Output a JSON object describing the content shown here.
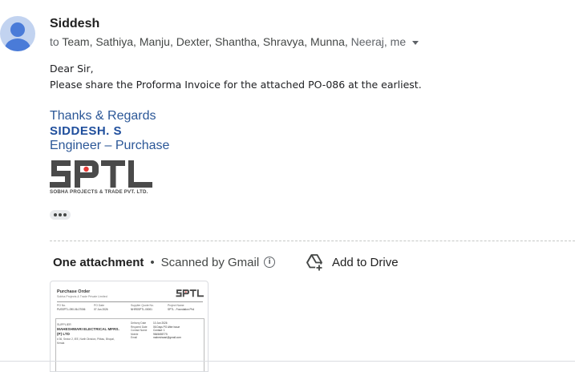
{
  "header": {
    "sender": "Siddesh",
    "to_prefix": "to",
    "recipients": "Team, Sathiya, Manju, Dexter, Shantha, Shravya, Munna,",
    "recipients_tail": "Neeraj, me"
  },
  "body": {
    "greeting": "Dear Sir,",
    "message": "Please share the Proforma Invoice for the attached PO-086 at the earliest."
  },
  "signature": {
    "line1": "Thanks & Regards",
    "name": "SIDDESH. S",
    "role": "Engineer – Purchase",
    "logo_text": "SPTL",
    "company": "SOBHA PROJECTS & TRADE PVT. LTD."
  },
  "attachments": {
    "title": "One attachment",
    "bullet": "•",
    "scanned": "Scanned by Gmail",
    "info_glyph": "i",
    "add_to_drive": "Add to Drive",
    "drive_icon": "add-to-drive-icon"
  },
  "thumbnail": {
    "doc_title": "Purchase Order",
    "doc_subtitle": "Sobha Projects & Trade Private Limited",
    "col_labels": [
      "PO No.",
      "PO Date",
      "Supplier Quote No.",
      "Project Name"
    ],
    "col_values": [
      "PUSSPTL-090-06-07006",
      "07 Jun 2026",
      "NHRSSPTL-00001",
      "SPTL - Foundation Ph4"
    ],
    "supplier_header": "SUPPLIER",
    "supplier_name": "MAHESHWARI ELECTRICAL MFRS.(P) LTD",
    "supplier_address": "# 36, Sector 2, IEE, North Division, Pitbau, Bhopal, Kerala",
    "kv_keys": [
      "Delivery Date",
      "Required Date",
      "Contact Name",
      "Mobile",
      "Email"
    ],
    "kv_values": [
      "10 Jun 2026",
      "06 Days PO After Issue",
      "Contact: 1",
      "9845655775",
      "maheshwari@gmail.com"
    ]
  },
  "colors": {
    "accent_blue": "#2b5797",
    "avatar_bg": "#c2d3f0",
    "avatar_fg": "#4a7bd8"
  }
}
